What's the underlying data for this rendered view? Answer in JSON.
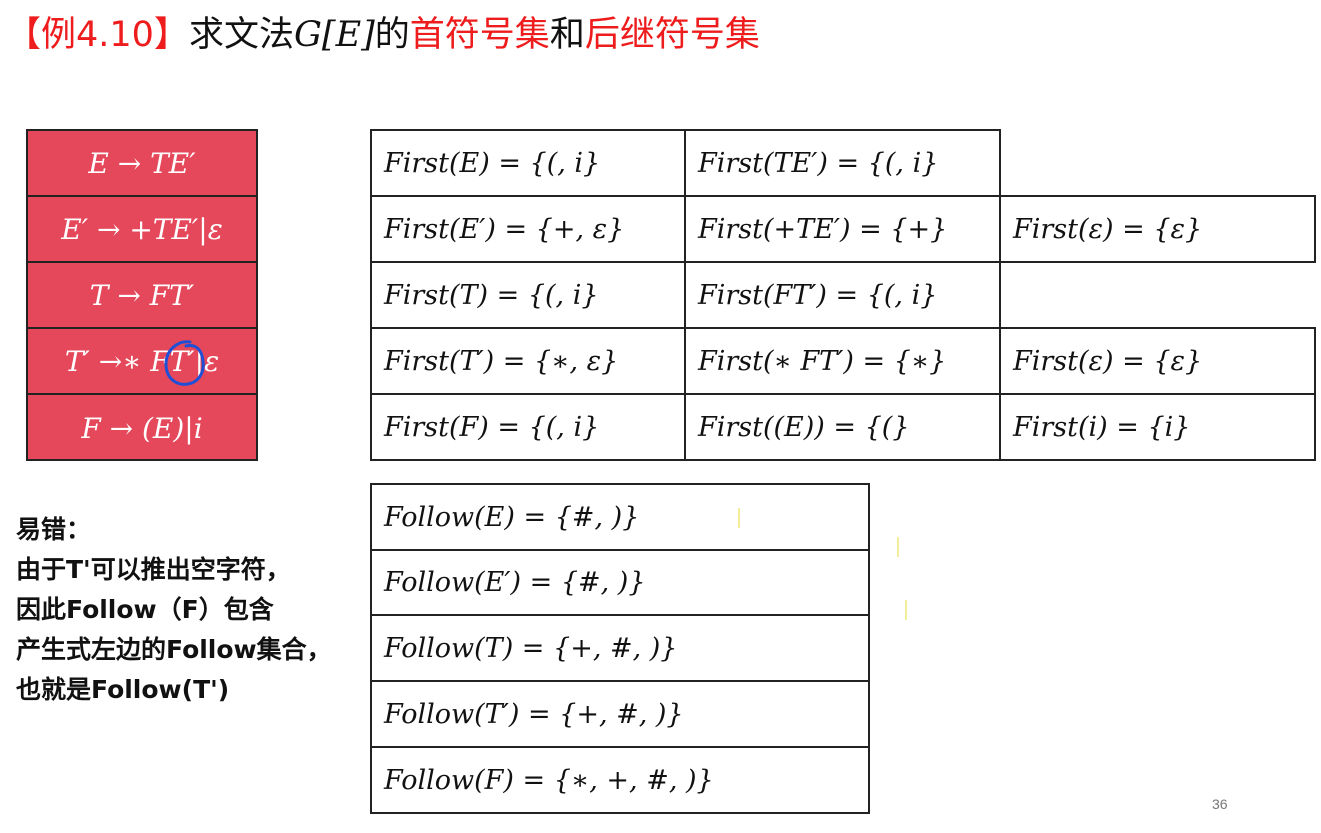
{
  "title": {
    "bracket_open": "【例4.10】",
    "prefix": "求文法",
    "grammar_name": "G[E]",
    "of": "的",
    "first_sets": "首符号集",
    "and": "和",
    "follow_sets": "后继符号集"
  },
  "grammar": [
    "E → TE′",
    "E′ → +TE′|ε",
    "T → FT′",
    "T′ →∗ FT′|ε",
    "F → (E)|i"
  ],
  "first_table": [
    [
      "First(E) = {(, i}",
      "First(TE′) = {(, i}",
      ""
    ],
    [
      "First(E′) = {+, ε}",
      "First(+TE′) = {+}",
      "First(ε) = {ε}"
    ],
    [
      "First(T) = {(, i}",
      "First(FT′) = {(, i}",
      ""
    ],
    [
      "First(T′) = {∗, ε}",
      "First(∗ FT′) = {∗}",
      "First(ε) = {ε}"
    ],
    [
      "First(F) = {(, i}",
      "First((E)) = {(}",
      "First(i) = {i}"
    ]
  ],
  "follow_table": [
    "Follow(E) = {#, )}",
    "Follow(E′) = {#, )}",
    "Follow(T) = {+, #, )}",
    "Follow(T′) = {+, #, )}",
    "Follow(F) = {∗, +, #, )}"
  ],
  "note": {
    "heading": "易错：",
    "lines": [
      "由于T'可以推出空字符，",
      "因此Follow（F）包含",
      "产生式左边的Follow集合，",
      "也就是Follow(T')"
    ]
  },
  "page_number": "36",
  "colors": {
    "accent_red": "#ee1c1c",
    "grammar_bg": "#e5485a",
    "annotation_blue": "#1f4fd6"
  }
}
